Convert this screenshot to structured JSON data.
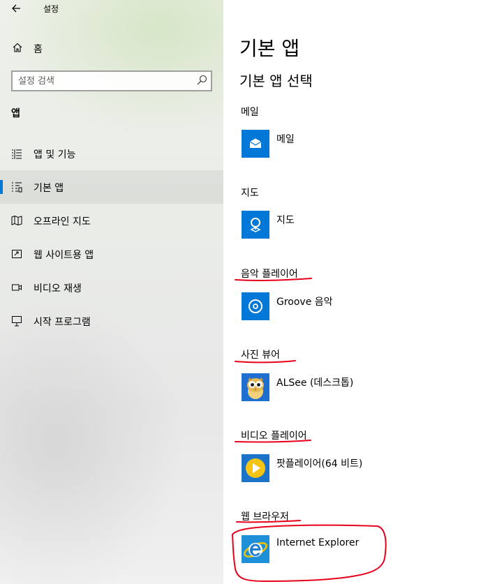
{
  "window": {
    "title": "설정"
  },
  "sidebar": {
    "home_label": "홈",
    "search": {
      "placeholder": "설정 검색"
    },
    "section": "앱",
    "items": [
      {
        "label": "앱 및 기능",
        "icon": "list-icon",
        "active": false
      },
      {
        "label": "기본 앱",
        "icon": "default-apps-icon",
        "active": true
      },
      {
        "label": "오프라인 지도",
        "icon": "map-icon",
        "active": false
      },
      {
        "label": "웹 사이트용 앱",
        "icon": "web-apps-icon",
        "active": false
      },
      {
        "label": "비디오 재생",
        "icon": "video-icon",
        "active": false
      },
      {
        "label": "시작 프로그램",
        "icon": "startup-icon",
        "active": false
      }
    ]
  },
  "main": {
    "title": "기본 앱",
    "subtitle": "기본 앱 선택",
    "categories": [
      {
        "label": "메일",
        "app": "메일",
        "icon": "mail-icon",
        "color": "#0078d7"
      },
      {
        "label": "지도",
        "app": "지도",
        "icon": "maps-icon",
        "color": "#0078d7"
      },
      {
        "label": "음악 플레이어",
        "app": "Groove 음악",
        "icon": "groove-icon",
        "color": "#0078d7"
      },
      {
        "label": "사진 뷰어",
        "app": "ALSee (데스크톱)",
        "icon": "alsee-icon",
        "color": "#1e6fd0"
      },
      {
        "label": "비디오 플레이어",
        "app": "팟플레이어(64 비트)",
        "icon": "potplayer-icon",
        "color": "#1a73c8"
      },
      {
        "label": "웹 브라우저",
        "app": "Internet Explorer",
        "icon": "ie-icon",
        "color": "#1e90d8"
      }
    ]
  },
  "colors": {
    "accent": "#0078d7",
    "annotation": "#e8001a"
  }
}
